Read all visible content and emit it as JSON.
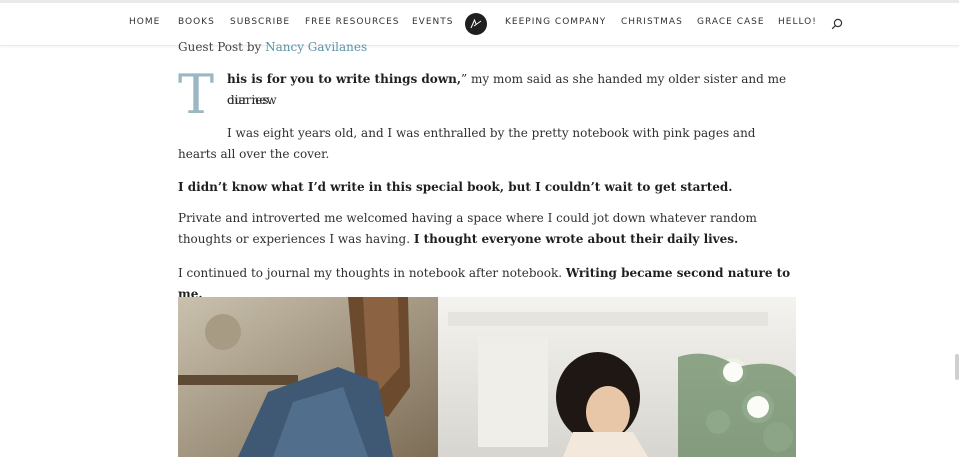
{
  "nav": {
    "items": [
      {
        "label": "HOME"
      },
      {
        "label": "BOOKS"
      },
      {
        "label": "SUBSCRIBE"
      },
      {
        "label": "FREE RESOURCES"
      },
      {
        "label": "EVENTS"
      },
      {
        "label": "KEEPING COMPANY"
      },
      {
        "label": "CHRISTMAS"
      },
      {
        "label": "GRACE CASE"
      },
      {
        "label": "HELLO!"
      }
    ],
    "logo_icon": "initials-logo-icon",
    "search_icon": "search-icon"
  },
  "article": {
    "guest_prefix": "Guest Post by",
    "author": "Nancy Gavilanes",
    "dropcap": "T",
    "p1_bold": "his is for you to write things down,",
    "p1_rest": "” my mom said as she handed my older sister and me our new",
    "p1_line2": "diaries.",
    "p2": "I was eight years old, and I was enthralled by the pretty notebook with pink pages and hearts all over the cover.",
    "p3_bold": "I didn’t know what I’d write in this special book, but I couldn’t wait to get started.",
    "p4_regular": "Private and introverted me welcomed having a space where I could jot down whatever random thoughts or experiences I was having.",
    "p4_bold": "I thought everyone wrote about their daily lives.",
    "p5_regular": "I continued to journal my thoughts in notebook after notebook.",
    "p5_bold": "Writing became second nature to me."
  },
  "colors": {
    "link": "#5b93a7",
    "dropcap": "#9bb7c3",
    "logo_bg": "#1f1f1f"
  }
}
